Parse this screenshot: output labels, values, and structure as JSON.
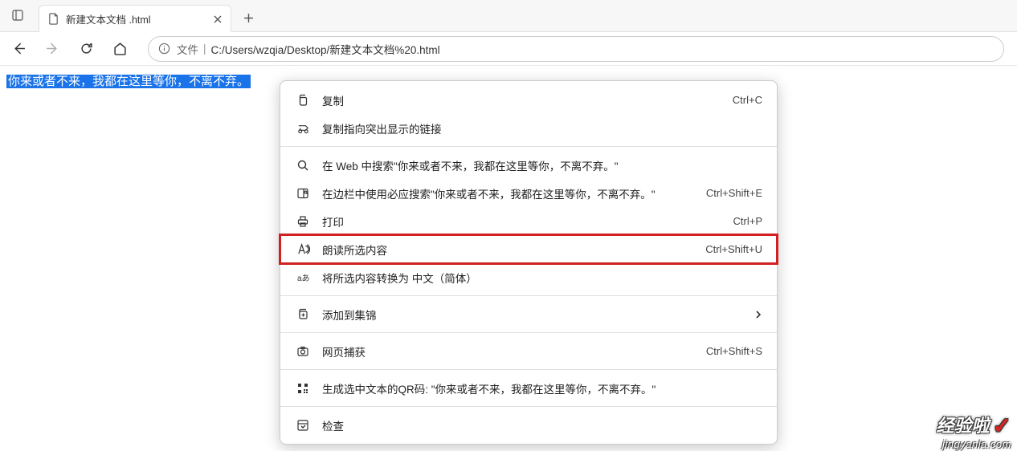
{
  "tab": {
    "title": "新建文本文档 .html"
  },
  "address": {
    "scheme": "文件",
    "path": "C:/Users/wzqia/Desktop/新建文本文档%20.html"
  },
  "page": {
    "selected_text": "你来或者不来，我都在这里等你，不离不弃。"
  },
  "context_menu": {
    "items": [
      {
        "label": "复制",
        "shortcut": "Ctrl+C",
        "icon": "copy-icon"
      },
      {
        "label": "复制指向突出显示的链接",
        "shortcut": "",
        "icon": "copy-link-icon"
      },
      {
        "label": "在 Web 中搜索\"你来或者不来，我都在这里等你，不离不弃。\"",
        "shortcut": "",
        "icon": "search-icon"
      },
      {
        "label": "在边栏中使用必应搜索\"你来或者不来，我都在这里等你，不离不弃。\"",
        "shortcut": "Ctrl+Shift+E",
        "icon": "sidebar-search-icon"
      },
      {
        "label": "打印",
        "shortcut": "Ctrl+P",
        "icon": "print-icon"
      },
      {
        "label": "朗读所选内容",
        "shortcut": "Ctrl+Shift+U",
        "icon": "read-aloud-icon",
        "highlight": true
      },
      {
        "label": "将所选内容转换为 中文（简体）",
        "shortcut": "",
        "icon": "translate-icon"
      },
      {
        "label": "添加到集锦",
        "shortcut": "",
        "icon": "collections-icon",
        "arrow": true
      },
      {
        "label": "网页捕获",
        "shortcut": "Ctrl+Shift+S",
        "icon": "capture-icon"
      },
      {
        "label": "生成选中文本的QR码: \"你来或者不来，我都在这里等你，不离不弃。\"",
        "shortcut": "",
        "icon": "qr-icon"
      },
      {
        "label": "检查",
        "shortcut": "",
        "icon": "inspect-icon"
      }
    ],
    "separators_after": [
      1,
      6,
      7,
      8,
      9
    ]
  },
  "watermark": {
    "top": "经验啦",
    "bottom": "jingyanla.com"
  }
}
